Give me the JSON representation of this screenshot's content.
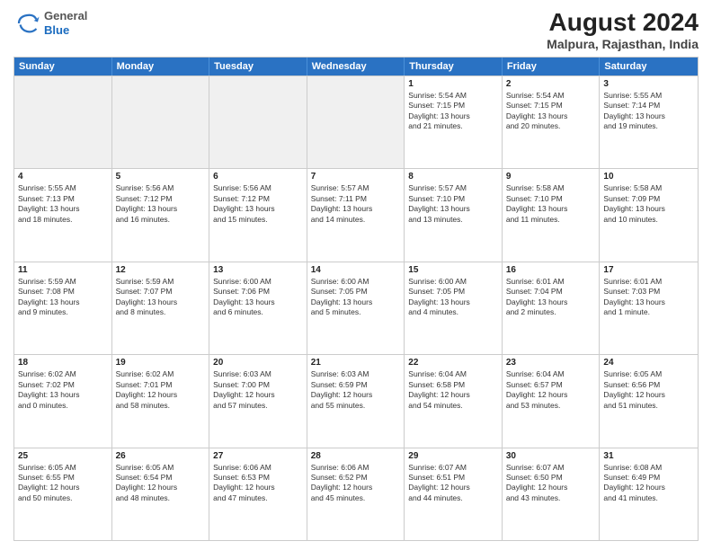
{
  "header": {
    "logo_general": "General",
    "logo_blue": "Blue",
    "title": "August 2024",
    "subtitle": "Malpura, Rajasthan, India"
  },
  "weekdays": [
    "Sunday",
    "Monday",
    "Tuesday",
    "Wednesday",
    "Thursday",
    "Friday",
    "Saturday"
  ],
  "weeks": [
    [
      {
        "day": "",
        "info": "",
        "shaded": true
      },
      {
        "day": "",
        "info": "",
        "shaded": true
      },
      {
        "day": "",
        "info": "",
        "shaded": true
      },
      {
        "day": "",
        "info": "",
        "shaded": true
      },
      {
        "day": "1",
        "info": "Sunrise: 5:54 AM\nSunset: 7:15 PM\nDaylight: 13 hours\nand 21 minutes.",
        "shaded": false
      },
      {
        "day": "2",
        "info": "Sunrise: 5:54 AM\nSunset: 7:15 PM\nDaylight: 13 hours\nand 20 minutes.",
        "shaded": false
      },
      {
        "day": "3",
        "info": "Sunrise: 5:55 AM\nSunset: 7:14 PM\nDaylight: 13 hours\nand 19 minutes.",
        "shaded": false
      }
    ],
    [
      {
        "day": "4",
        "info": "Sunrise: 5:55 AM\nSunset: 7:13 PM\nDaylight: 13 hours\nand 18 minutes.",
        "shaded": false
      },
      {
        "day": "5",
        "info": "Sunrise: 5:56 AM\nSunset: 7:12 PM\nDaylight: 13 hours\nand 16 minutes.",
        "shaded": false
      },
      {
        "day": "6",
        "info": "Sunrise: 5:56 AM\nSunset: 7:12 PM\nDaylight: 13 hours\nand 15 minutes.",
        "shaded": false
      },
      {
        "day": "7",
        "info": "Sunrise: 5:57 AM\nSunset: 7:11 PM\nDaylight: 13 hours\nand 14 minutes.",
        "shaded": false
      },
      {
        "day": "8",
        "info": "Sunrise: 5:57 AM\nSunset: 7:10 PM\nDaylight: 13 hours\nand 13 minutes.",
        "shaded": false
      },
      {
        "day": "9",
        "info": "Sunrise: 5:58 AM\nSunset: 7:10 PM\nDaylight: 13 hours\nand 11 minutes.",
        "shaded": false
      },
      {
        "day": "10",
        "info": "Sunrise: 5:58 AM\nSunset: 7:09 PM\nDaylight: 13 hours\nand 10 minutes.",
        "shaded": false
      }
    ],
    [
      {
        "day": "11",
        "info": "Sunrise: 5:59 AM\nSunset: 7:08 PM\nDaylight: 13 hours\nand 9 minutes.",
        "shaded": false
      },
      {
        "day": "12",
        "info": "Sunrise: 5:59 AM\nSunset: 7:07 PM\nDaylight: 13 hours\nand 8 minutes.",
        "shaded": false
      },
      {
        "day": "13",
        "info": "Sunrise: 6:00 AM\nSunset: 7:06 PM\nDaylight: 13 hours\nand 6 minutes.",
        "shaded": false
      },
      {
        "day": "14",
        "info": "Sunrise: 6:00 AM\nSunset: 7:05 PM\nDaylight: 13 hours\nand 5 minutes.",
        "shaded": false
      },
      {
        "day": "15",
        "info": "Sunrise: 6:00 AM\nSunset: 7:05 PM\nDaylight: 13 hours\nand 4 minutes.",
        "shaded": false
      },
      {
        "day": "16",
        "info": "Sunrise: 6:01 AM\nSunset: 7:04 PM\nDaylight: 13 hours\nand 2 minutes.",
        "shaded": false
      },
      {
        "day": "17",
        "info": "Sunrise: 6:01 AM\nSunset: 7:03 PM\nDaylight: 13 hours\nand 1 minute.",
        "shaded": false
      }
    ],
    [
      {
        "day": "18",
        "info": "Sunrise: 6:02 AM\nSunset: 7:02 PM\nDaylight: 13 hours\nand 0 minutes.",
        "shaded": false
      },
      {
        "day": "19",
        "info": "Sunrise: 6:02 AM\nSunset: 7:01 PM\nDaylight: 12 hours\nand 58 minutes.",
        "shaded": false
      },
      {
        "day": "20",
        "info": "Sunrise: 6:03 AM\nSunset: 7:00 PM\nDaylight: 12 hours\nand 57 minutes.",
        "shaded": false
      },
      {
        "day": "21",
        "info": "Sunrise: 6:03 AM\nSunset: 6:59 PM\nDaylight: 12 hours\nand 55 minutes.",
        "shaded": false
      },
      {
        "day": "22",
        "info": "Sunrise: 6:04 AM\nSunset: 6:58 PM\nDaylight: 12 hours\nand 54 minutes.",
        "shaded": false
      },
      {
        "day": "23",
        "info": "Sunrise: 6:04 AM\nSunset: 6:57 PM\nDaylight: 12 hours\nand 53 minutes.",
        "shaded": false
      },
      {
        "day": "24",
        "info": "Sunrise: 6:05 AM\nSunset: 6:56 PM\nDaylight: 12 hours\nand 51 minutes.",
        "shaded": false
      }
    ],
    [
      {
        "day": "25",
        "info": "Sunrise: 6:05 AM\nSunset: 6:55 PM\nDaylight: 12 hours\nand 50 minutes.",
        "shaded": false
      },
      {
        "day": "26",
        "info": "Sunrise: 6:05 AM\nSunset: 6:54 PM\nDaylight: 12 hours\nand 48 minutes.",
        "shaded": false
      },
      {
        "day": "27",
        "info": "Sunrise: 6:06 AM\nSunset: 6:53 PM\nDaylight: 12 hours\nand 47 minutes.",
        "shaded": false
      },
      {
        "day": "28",
        "info": "Sunrise: 6:06 AM\nSunset: 6:52 PM\nDaylight: 12 hours\nand 45 minutes.",
        "shaded": false
      },
      {
        "day": "29",
        "info": "Sunrise: 6:07 AM\nSunset: 6:51 PM\nDaylight: 12 hours\nand 44 minutes.",
        "shaded": false
      },
      {
        "day": "30",
        "info": "Sunrise: 6:07 AM\nSunset: 6:50 PM\nDaylight: 12 hours\nand 43 minutes.",
        "shaded": false
      },
      {
        "day": "31",
        "info": "Sunrise: 6:08 AM\nSunset: 6:49 PM\nDaylight: 12 hours\nand 41 minutes.",
        "shaded": false
      }
    ]
  ]
}
